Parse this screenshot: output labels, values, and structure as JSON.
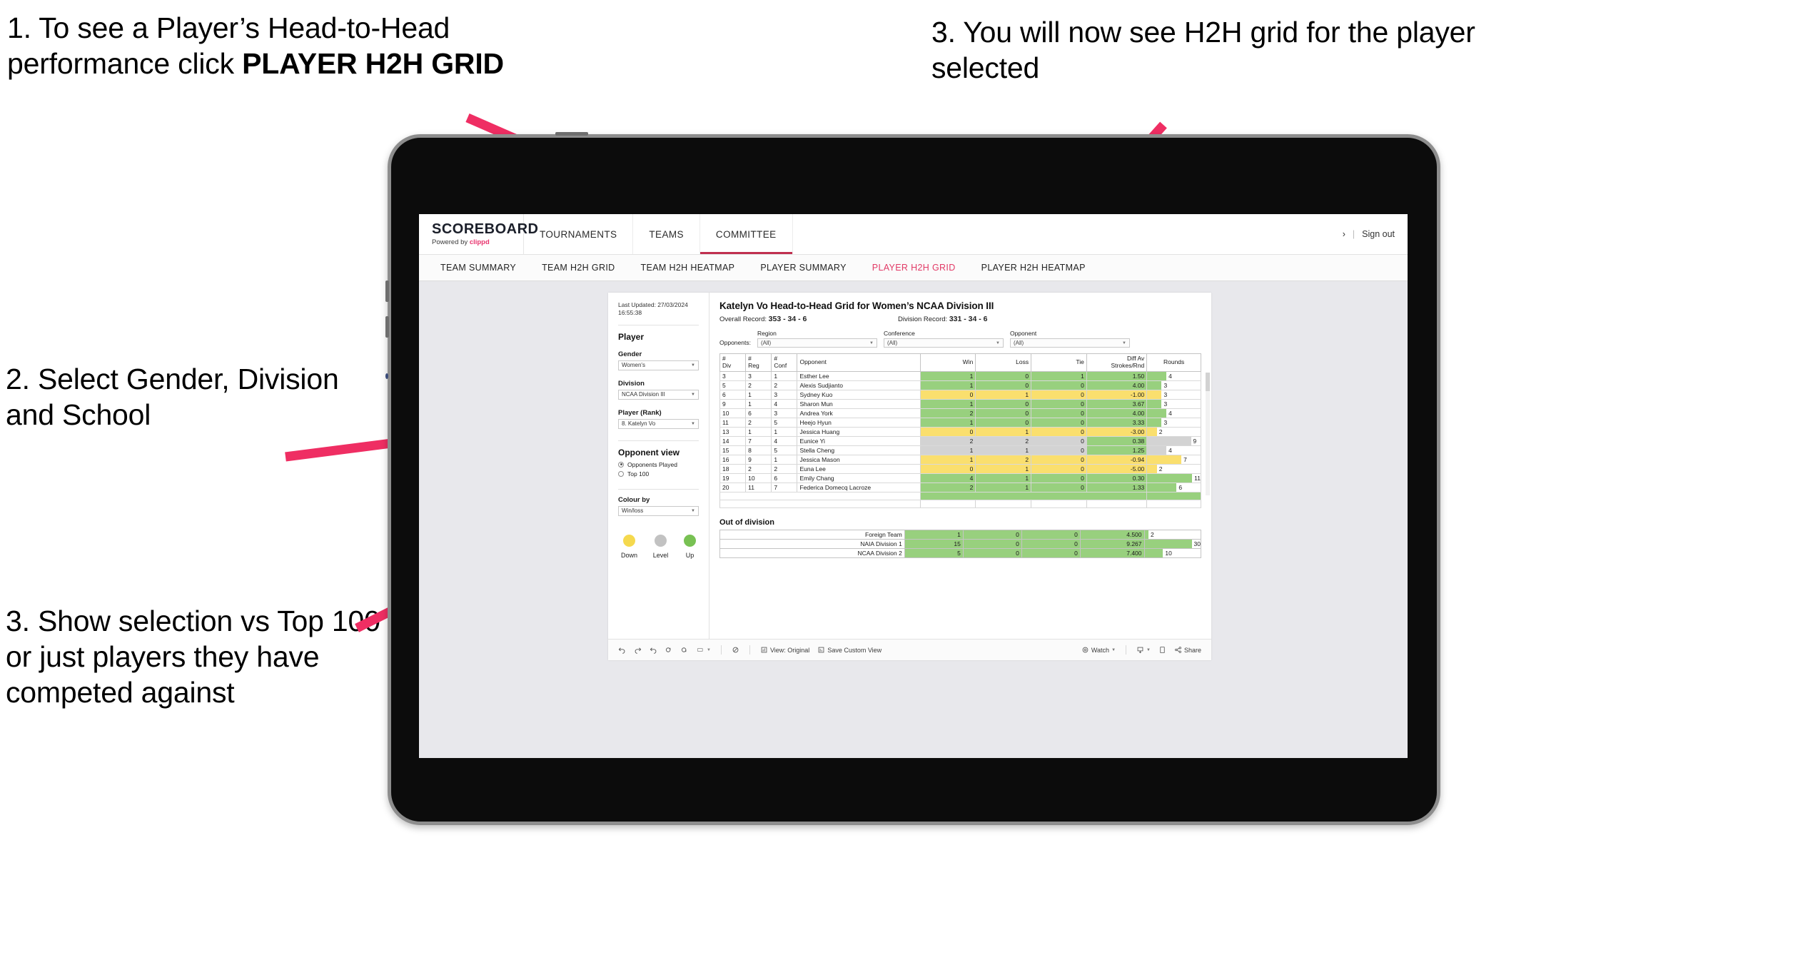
{
  "annotations": [
    {
      "id": "a1",
      "plain": "1. To see a Player’s Head-to-Head performance click ",
      "bold": "PLAYER H2H GRID"
    },
    {
      "id": "a2",
      "text": "2. Select Gender, Division and School"
    },
    {
      "id": "a3",
      "text": "3. Show selection vs Top 100 or just players they have competed against"
    },
    {
      "id": "a4",
      "text": "3. You will now see H2H grid for the player selected"
    }
  ],
  "accent_color": "#ef2e63",
  "app": {
    "logo": {
      "main": "SCOREBOARD",
      "sub_prefix": "Powered by ",
      "brand": "clippd"
    },
    "topnav": [
      {
        "label": "TOURNAMENTS",
        "active": false
      },
      {
        "label": "TEAMS",
        "active": false
      },
      {
        "label": "COMMITTEE",
        "active": true
      }
    ],
    "topbar_right": {
      "chevron": "›",
      "sep": "|",
      "sign_out": "Sign out"
    },
    "subnav": [
      {
        "label": "TEAM SUMMARY",
        "active": false
      },
      {
        "label": "TEAM H2H GRID",
        "active": false
      },
      {
        "label": "TEAM H2H HEATMAP",
        "active": false
      },
      {
        "label": "PLAYER SUMMARY",
        "active": false
      },
      {
        "label": "PLAYER H2H GRID",
        "active": true
      },
      {
        "label": "PLAYER H2H HEATMAP",
        "active": false
      }
    ]
  },
  "sidebar": {
    "last_updated_line1": "Last Updated: 27/03/2024",
    "last_updated_line2": "16:55:38",
    "player_heading": "Player",
    "gender": {
      "label": "Gender",
      "value": "Women's"
    },
    "division": {
      "label": "Division",
      "value": "NCAA Division III"
    },
    "player_rank": {
      "label": "Player (Rank)",
      "value": "8. Katelyn Vo"
    },
    "opponent_view": {
      "heading": "Opponent view",
      "options": [
        {
          "label": "Opponents Played",
          "selected": true
        },
        {
          "label": "Top 100",
          "selected": false
        }
      ]
    },
    "colour_by": {
      "label": "Colour by",
      "value": "Win/loss"
    },
    "legend": [
      {
        "caption": "Down",
        "color": "#f5d94e"
      },
      {
        "caption": "Level",
        "color": "#c2c2c2"
      },
      {
        "caption": "Up",
        "color": "#78c153"
      }
    ]
  },
  "viz": {
    "title": "Katelyn Vo Head-to-Head Grid for Women’s NCAA Division III",
    "overall_record_label": "Overall Record:",
    "overall_record_value": "353 - 34 - 6",
    "division_record_label": "Division Record:",
    "division_record_value": "331 - 34 - 6",
    "opponents_label": "Opponents:",
    "filters": [
      {
        "title": "Region",
        "value": "(All)"
      },
      {
        "title": "Conference",
        "value": "(All)"
      },
      {
        "title": "Opponent",
        "value": "(All)"
      }
    ]
  },
  "chart_data": {
    "type": "table",
    "title": "Katelyn Vo Head-to-Head Grid for Women’s NCAA Division III",
    "columns": [
      "# Div",
      "# Reg",
      "# Conf",
      "Opponent",
      "Win",
      "Loss",
      "Tie",
      "Diff Av Strokes/Rnd",
      "Rounds"
    ],
    "column_header_lines": [
      [
        "#",
        "Div"
      ],
      [
        "#",
        "Reg"
      ],
      [
        "#",
        "Conf"
      ],
      [
        "Opponent"
      ],
      [
        "Win"
      ],
      [
        "Loss"
      ],
      [
        "Tie"
      ],
      [
        "Diff Av",
        "Strokes/Rnd"
      ],
      [
        "Rounds"
      ]
    ],
    "rounds_max": 11,
    "colors": {
      "up": "#98d07e",
      "down": "#fadf6e",
      "level": "#d3d3d3"
    },
    "rows": [
      {
        "div": "3",
        "reg": "3",
        "conf": "1",
        "opponent": "Esther Lee",
        "win": "1",
        "loss": "0",
        "tie": "1",
        "diff": "1.50",
        "rounds": "4",
        "state": "up"
      },
      {
        "div": "5",
        "reg": "2",
        "conf": "2",
        "opponent": "Alexis Sudjianto",
        "win": "1",
        "loss": "0",
        "tie": "0",
        "diff": "4.00",
        "rounds": "3",
        "state": "up"
      },
      {
        "div": "6",
        "reg": "1",
        "conf": "3",
        "opponent": "Sydney Kuo",
        "win": "0",
        "loss": "1",
        "tie": "0",
        "diff": "-1.00",
        "rounds": "3",
        "state": "down"
      },
      {
        "div": "9",
        "reg": "1",
        "conf": "4",
        "opponent": "Sharon Mun",
        "win": "1",
        "loss": "0",
        "tie": "0",
        "diff": "3.67",
        "rounds": "3",
        "state": "up"
      },
      {
        "div": "10",
        "reg": "6",
        "conf": "3",
        "opponent": "Andrea York",
        "win": "2",
        "loss": "0",
        "tie": "0",
        "diff": "4.00",
        "rounds": "4",
        "state": "up"
      },
      {
        "div": "11",
        "reg": "2",
        "conf": "5",
        "opponent": "Heejo Hyun",
        "win": "1",
        "loss": "0",
        "tie": "0",
        "diff": "3.33",
        "rounds": "3",
        "state": "up"
      },
      {
        "div": "13",
        "reg": "1",
        "conf": "1",
        "opponent": "Jessica Huang",
        "win": "0",
        "loss": "1",
        "tie": "0",
        "diff": "-3.00",
        "rounds": "2",
        "state": "down"
      },
      {
        "div": "14",
        "reg": "7",
        "conf": "4",
        "opponent": "Eunice Yi",
        "win": "2",
        "loss": "2",
        "tie": "0",
        "diff": "0.38",
        "rounds": "9",
        "state": "level",
        "diff_state": "up"
      },
      {
        "div": "15",
        "reg": "8",
        "conf": "5",
        "opponent": "Stella Cheng",
        "win": "1",
        "loss": "1",
        "tie": "0",
        "diff": "1.25",
        "rounds": "4",
        "state": "level",
        "diff_state": "up"
      },
      {
        "div": "16",
        "reg": "9",
        "conf": "1",
        "opponent": "Jessica Mason",
        "win": "1",
        "loss": "2",
        "tie": "0",
        "diff": "-0.94",
        "rounds": "7",
        "state": "down"
      },
      {
        "div": "18",
        "reg": "2",
        "conf": "2",
        "opponent": "Euna Lee",
        "win": "0",
        "loss": "1",
        "tie": "0",
        "diff": "-5.00",
        "rounds": "2",
        "state": "down"
      },
      {
        "div": "19",
        "reg": "10",
        "conf": "6",
        "opponent": "Emily Chang",
        "win": "4",
        "loss": "1",
        "tie": "0",
        "diff": "0.30",
        "rounds": "11",
        "state": "up"
      },
      {
        "div": "20",
        "reg": "11",
        "conf": "7",
        "opponent": "Federica Domecq Lacroze",
        "win": "2",
        "loss": "1",
        "tie": "0",
        "diff": "1.33",
        "rounds": "6",
        "state": "up"
      }
    ],
    "out_of_division": {
      "title": "Out of division",
      "rounds_max": 30,
      "rows": [
        {
          "label": "Foreign Team",
          "win": "1",
          "loss": "0",
          "tie": "0",
          "diff": "4.500",
          "rounds": "2",
          "state": "up"
        },
        {
          "label": "NAIA Division 1",
          "win": "15",
          "loss": "0",
          "tie": "0",
          "diff": "9.267",
          "rounds": "30",
          "state": "up"
        },
        {
          "label": "NCAA Division 2",
          "win": "5",
          "loss": "0",
          "tie": "0",
          "diff": "7.400",
          "rounds": "10",
          "state": "up"
        }
      ]
    }
  },
  "toolbar": {
    "undo": "undo-icon",
    "redo": "redo-icon",
    "revert": "revert-icon",
    "refresh": "refresh-data-icon",
    "pause": "pause-auto-update-icon",
    "view_original": "View: Original",
    "save_custom_view": "Save Custom View",
    "watch": "Watch",
    "share": "Share"
  }
}
